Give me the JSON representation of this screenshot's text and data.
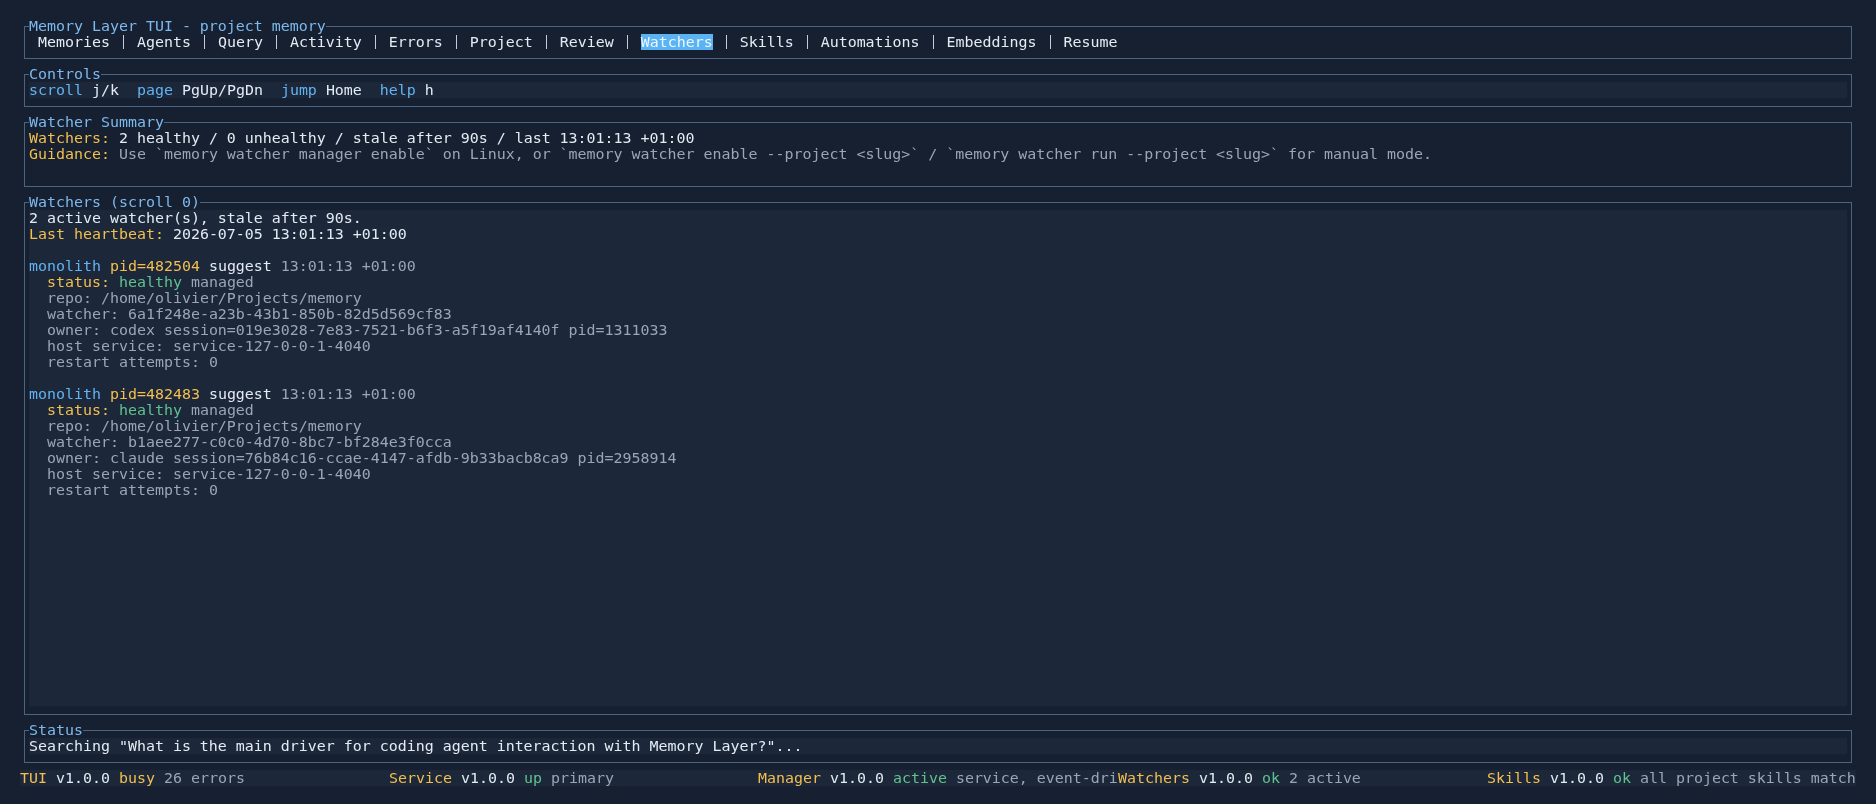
{
  "app": {
    "title": "Memory Layer TUI - project memory"
  },
  "tabs": [
    {
      "label": "Memories",
      "selected": false
    },
    {
      "label": "Agents",
      "selected": false
    },
    {
      "label": "Query",
      "selected": false
    },
    {
      "label": "Activity",
      "selected": false
    },
    {
      "label": "Errors",
      "selected": false
    },
    {
      "label": "Project",
      "selected": false
    },
    {
      "label": "Review",
      "selected": false
    },
    {
      "label": "Watchers",
      "selected": true
    },
    {
      "label": "Skills",
      "selected": false
    },
    {
      "label": "Automations",
      "selected": false
    },
    {
      "label": "Embeddings",
      "selected": false
    },
    {
      "label": "Resume",
      "selected": false
    }
  ],
  "controls": {
    "title": "Controls",
    "bindings": [
      {
        "action": "scroll",
        "key": "j/k"
      },
      {
        "action": "page",
        "key": "PgUp/PgDn"
      },
      {
        "action": "jump",
        "key": "Home"
      },
      {
        "action": "help",
        "key": "h"
      }
    ]
  },
  "summary": {
    "title": "Watcher Summary",
    "lines": [
      {
        "kind": "value",
        "label": "Watchers:",
        "text": "2 healthy / 0 unhealthy / stale after 90s / last 13:01:13 +01:00"
      },
      {
        "kind": "hint",
        "label": "Guidance:",
        "text": "Use `memory watcher manager enable` on Linux, or `memory watcher enable --project <slug>` / `memory watcher run --project <slug>` for manual mode."
      }
    ]
  },
  "watchers": {
    "title": "Watchers (scroll 0)",
    "intro": "2 active watcher(s), stale after 90s.",
    "heartbeat": {
      "label": "Last heartbeat:",
      "value": "2026-07-05 13:01:13 +01:00"
    },
    "items": [
      {
        "project": "monolith",
        "pid": "pid=482504",
        "mode": "suggest",
        "time": "13:01:13 +01:00",
        "status_label": "status:",
        "status": "healthy",
        "color": "#5fc28f",
        "management": "managed",
        "details": [
          "repo: /home/olivier/Projects/memory",
          "watcher: 6a1f248e-a23b-43b1-850b-82d5d569cf83",
          "owner: codex session=019e3028-7e83-7521-b6f3-a5f19af4140f pid=1311033",
          "host service: service-127-0-0-1-4040",
          "restart attempts: 0"
        ]
      },
      {
        "project": "monolith",
        "pid": "pid=482483",
        "mode": "suggest",
        "time": "13:01:13 +01:00",
        "status_label": "status:",
        "status": "healthy",
        "color": "#5fc28f",
        "management": "managed",
        "details": [
          "repo: /home/olivier/Projects/memory",
          "watcher: b1aee277-c0c0-4d70-8bc7-bf284e3f0cca",
          "owner: claude session=76b84c16-ccae-4147-afdb-9b33bacb8ca9 pid=2958914",
          "host service: service-127-0-0-1-4040",
          "restart attempts: 0"
        ]
      }
    ]
  },
  "status": {
    "title": "Status",
    "message": "Searching \"What is the main driver for coding agent interaction with Memory Layer?\"..."
  },
  "footer": [
    {
      "name": "TUI",
      "version": "v1.0.0",
      "state": "busy",
      "color": "#f3bf4f",
      "detail": "26 errors"
    },
    {
      "name": "Service",
      "version": "v1.0.0",
      "state": "up",
      "color": "#5fc28f",
      "detail": "primary"
    },
    {
      "name": "Manager",
      "version": "v1.0.0",
      "state": "active",
      "color": "#5fc28f",
      "detail": "service, event-dri"
    },
    {
      "name": "Watchers",
      "version": "v1.0.0",
      "state": "ok",
      "color": "#5fc28f",
      "detail": "2 active"
    },
    {
      "name": "Skills",
      "version": "v1.0.0",
      "state": "ok",
      "color": "#5fc28f",
      "detail": "all project skills match"
    }
  ]
}
